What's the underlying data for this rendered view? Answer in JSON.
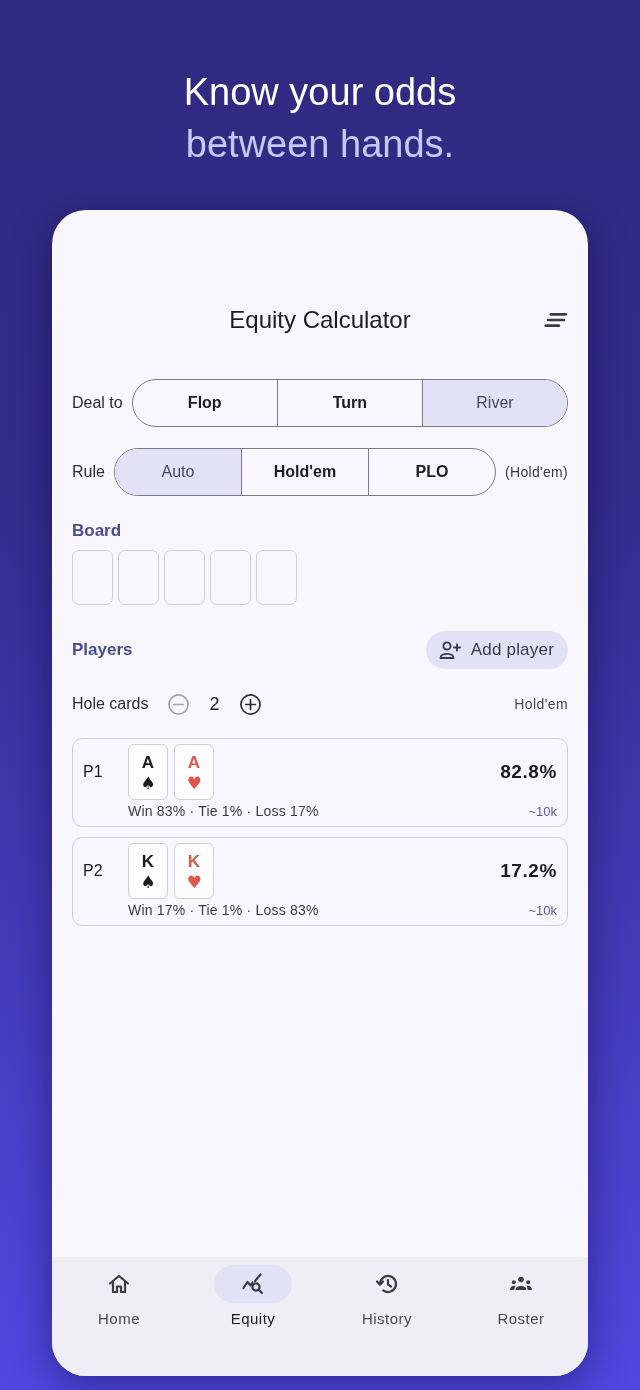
{
  "headline": {
    "line_1": "Know your odds",
    "line_2": "between hands."
  },
  "app_bar": {
    "title": "Equity Calculator"
  },
  "deal_to": {
    "label": "Deal to",
    "options": [
      {
        "label": "Flop",
        "selected": false
      },
      {
        "label": "Turn",
        "selected": false
      },
      {
        "label": "River",
        "selected": true
      }
    ]
  },
  "rule": {
    "label": "Rule",
    "options": [
      {
        "label": "Auto",
        "selected": true
      },
      {
        "label": "Hold'em",
        "selected": false
      },
      {
        "label": "PLO",
        "selected": false
      }
    ],
    "resolved": "(Hold'em)"
  },
  "board": {
    "heading": "Board",
    "slots": [
      {
        "kind": "empty"
      },
      {
        "kind": "empty"
      },
      {
        "kind": "empty"
      },
      {
        "kind": "empty"
      },
      {
        "kind": "empty"
      }
    ]
  },
  "players": {
    "heading": "Players",
    "add_button": "Add player",
    "hole_cards": {
      "label": "Hole cards",
      "count": "2",
      "decrement": {
        "disabled": true
      },
      "increment": {
        "disabled": false
      }
    },
    "game": "Hold'em",
    "list": [
      {
        "name": "P1",
        "cards": [
          {
            "rank": "A",
            "suit": "♠",
            "color": "#1c1b1f"
          },
          {
            "rank": "A",
            "suit": "♥",
            "color": "#e0574a"
          }
        ],
        "equity": "82.8%",
        "breakdown": "Win 83% · Tie 1% · Loss 17%",
        "samples": "~10k"
      },
      {
        "name": "P2",
        "cards": [
          {
            "rank": "K",
            "suit": "♠",
            "color": "#1c1b1f"
          },
          {
            "rank": "K",
            "suit": "♥",
            "color": "#e0574a"
          }
        ],
        "equity": "17.2%",
        "breakdown": "Win 17% · Tie 1% · Loss 83%",
        "samples": "~10k"
      }
    ]
  },
  "bottom_nav": [
    {
      "kind": "home",
      "label": "Home",
      "selected": false
    },
    {
      "kind": "equity",
      "label": "Equity",
      "selected": true
    },
    {
      "kind": "history",
      "label": "History",
      "selected": false
    },
    {
      "kind": "roster",
      "label": "Roster",
      "selected": false
    }
  ]
}
